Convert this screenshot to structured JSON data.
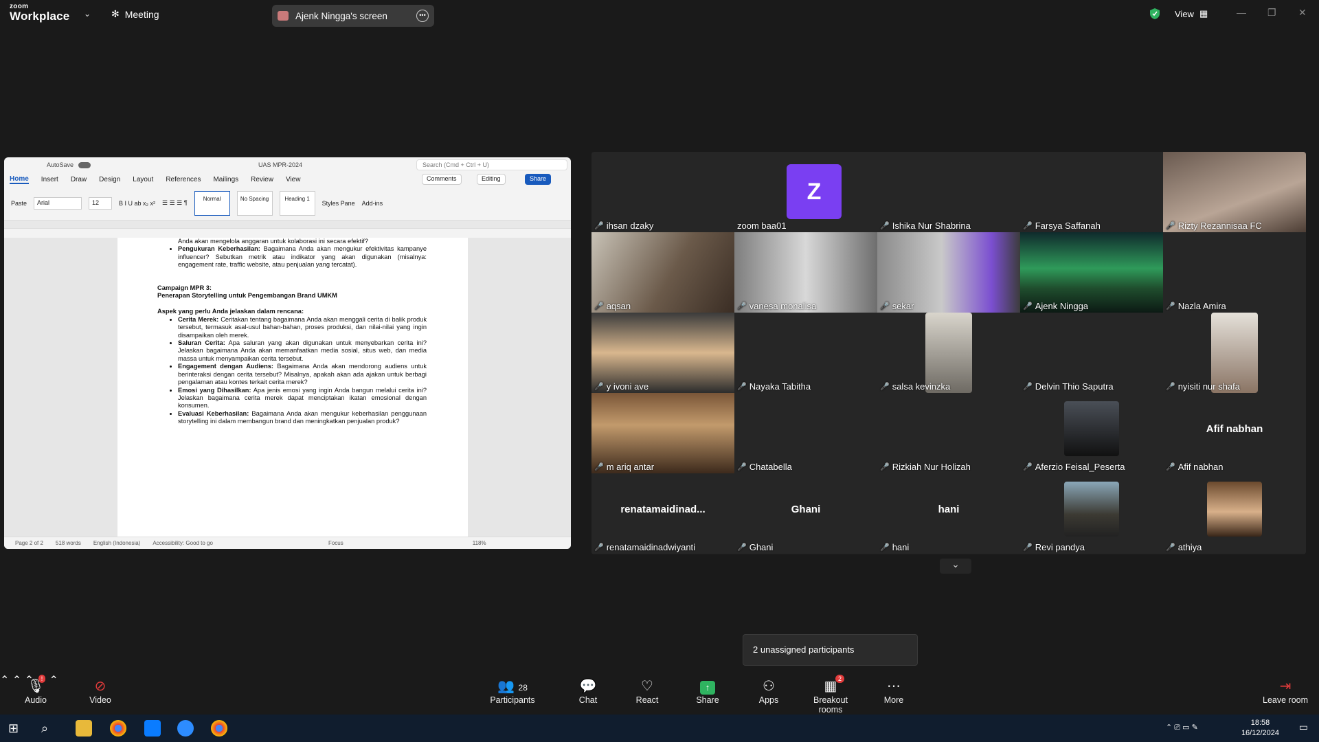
{
  "topbar": {
    "brand_line1": "zoom",
    "brand_line2": "Workplace",
    "meeting_label": "Meeting",
    "share_label": "Ajenk Ningga's screen",
    "view_label": "View"
  },
  "word": {
    "autosave": "AutoSave",
    "title": "UAS MPR-2024",
    "search_placeholder": "Search (Cmd + Ctrl + U)",
    "tabs": [
      "Home",
      "Insert",
      "Draw",
      "Design",
      "Layout",
      "References",
      "Mailings",
      "Review",
      "View"
    ],
    "comments": "Comments",
    "editing": "Editing",
    "share": "Share",
    "font": "Arial",
    "size": "12",
    "paste": "Paste",
    "styles": [
      "Normal",
      "No Spacing",
      "Heading 1"
    ],
    "styles_pane": "Styles Pane",
    "addins": "Add-ins",
    "doc": {
      "line_top": "Anda akan mengelola anggaran untuk kolaborasi ini secara efektif?",
      "bullet_top_bold": "Pengukuran Keberhasilan:",
      "bullet_top_text": " Bagaimana Anda akan mengukur efektivitas kampanye influencer? Sebutkan metrik atau indikator yang akan digunakan (misalnya: engagement rate, traffic website, atau penjualan yang tercatat).",
      "heading1": "Campaign MPR 3:",
      "heading2": "Penerapan Storytelling untuk Pengembangan Brand UMKM",
      "aspect": "Aspek yang perlu Anda jelaskan dalam rencana:",
      "bullets": [
        {
          "b": "Cerita Merek:",
          "t": " Ceritakan tentang bagaimana Anda akan menggali cerita di balik produk tersebut, termasuk asal-usul bahan-bahan, proses produksi, dan nilai-nilai yang ingin disampaikan oleh merek."
        },
        {
          "b": "Saluran Cerita:",
          "t": " Apa saluran yang akan digunakan untuk menyebarkan cerita ini? Jelaskan bagaimana Anda akan memanfaatkan media sosial, situs web, dan media massa untuk menyampaikan cerita tersebut."
        },
        {
          "b": "Engagement dengan Audiens:",
          "t": " Bagaimana Anda akan mendorong audiens untuk berinteraksi dengan cerita tersebut? Misalnya, apakah akan ada ajakan untuk berbagi pengalaman atau kontes terkait cerita merek?"
        },
        {
          "b": "Emosi yang Dihasilkan:",
          "t": " Apa jenis emosi yang ingin Anda bangun melalui cerita ini? Jelaskan bagaimana cerita merek dapat menciptakan ikatan emosional dengan konsumen."
        },
        {
          "b": "Evaluasi Keberhasilan:",
          "t": " Bagaimana Anda akan mengukur keberhasilan penggunaan storytelling ini dalam membangun brand dan meningkatkan penjualan produk?"
        }
      ]
    },
    "status": {
      "page": "Page 2 of 2",
      "words": "518 words",
      "lang": "English (Indonesia)",
      "access": "Accessibility: Good to go",
      "focus": "Focus",
      "zoom": "118%"
    }
  },
  "participants": [
    {
      "name": "ihsan dzaky"
    },
    {
      "name": "zoom baa01",
      "avatar": "Z"
    },
    {
      "name": "Ishika Nur Shabrina"
    },
    {
      "name": "Farsya Saffanah"
    },
    {
      "name": "Rizty Rezannisaa FC"
    },
    {
      "name": "aqsan"
    },
    {
      "name": "vanesa monalisa"
    },
    {
      "name": "sekar"
    },
    {
      "name": "Ajenk Ningga"
    },
    {
      "name": "Nazla Amira"
    },
    {
      "name": "y ivoni ave"
    },
    {
      "name": "Nayaka Tabitha"
    },
    {
      "name": "salsa kevinzka"
    },
    {
      "name": "Delvin Thio Saputra"
    },
    {
      "name": "nyisiti nur shafa"
    },
    {
      "name": "m ariq antar"
    },
    {
      "name": "Chatabella"
    },
    {
      "name": "Rizkiah Nur Holizah"
    },
    {
      "name": "Aferzio Feisal_Peserta"
    },
    {
      "name": "Afif nabhan",
      "big": "Afif nabhan"
    },
    {
      "name": "renatamaidinadwiyanti",
      "big": "renatamaidinad..."
    },
    {
      "name": "Ghani",
      "big": "Ghani"
    },
    {
      "name": "hani",
      "big": "hani"
    },
    {
      "name": "Revi pandya"
    },
    {
      "name": "athiya"
    }
  ],
  "unassigned": "2 unassigned participants",
  "toolbar": {
    "audio": "Audio",
    "video": "Video",
    "participants": "Participants",
    "participants_count": "28",
    "chat": "Chat",
    "react": "React",
    "share": "Share",
    "apps": "Apps",
    "breakout": "Breakout rooms",
    "breakout_badge": "2",
    "more": "More",
    "leave": "Leave room"
  },
  "taskbar": {
    "time": "18:58",
    "date": "16/12/2024"
  }
}
